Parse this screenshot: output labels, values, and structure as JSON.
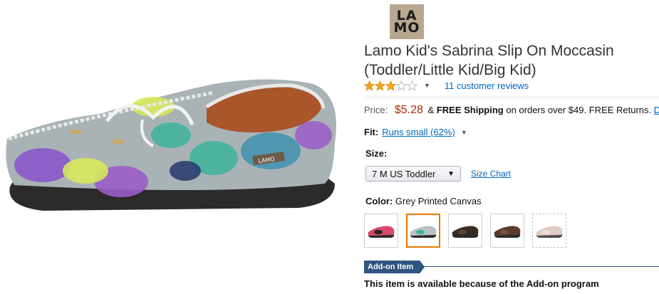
{
  "brand": {
    "logo_text_line1": "LA",
    "logo_text_line2": "MO"
  },
  "product": {
    "title": "Lamo Kid's Sabrina Slip On Moccasin (Toddler/Little Kid/Big Kid)",
    "shoe_tag": "LAMO"
  },
  "rating": {
    "stars": 3,
    "max_stars": 5,
    "reviews_label": "11 customer reviews"
  },
  "price": {
    "label": "Price:",
    "value": "$5.28",
    "amp": "&",
    "free_shipping": "FREE Shipping",
    "conditions": "on orders over $49.",
    "free_returns": "FREE Returns.",
    "link_fragment": "D"
  },
  "fit": {
    "label": "Fit:",
    "value": "Runs small (62%)"
  },
  "size": {
    "label": "Size:",
    "selected": "7 M US Toddler",
    "chart_link": "Size Chart"
  },
  "color": {
    "label": "Color:",
    "selected": "Grey Printed Canvas",
    "swatches": [
      {
        "name": "pink-zebra",
        "upper": "#d94a6a",
        "pattern": "#222222",
        "selected": false
      },
      {
        "name": "grey-printed-canvas",
        "upper": "#b8c2c8",
        "pattern": "#3bb89a",
        "selected": true
      },
      {
        "name": "dark-brown",
        "upper": "#3a2a20",
        "pattern": "#5a4434",
        "selected": false
      },
      {
        "name": "brown",
        "upper": "#5c3a2e",
        "pattern": "#7a5444",
        "selected": false
      },
      {
        "name": "tan-unavailable",
        "upper": "#d9c4b6",
        "pattern": "#e8d8cc",
        "selected": false
      }
    ]
  },
  "addon": {
    "badge": "Add-on Item",
    "text": "This item is available because of the Add-on program",
    "color": "#2f5580"
  },
  "colors": {
    "link": "#0066c0",
    "price": "#b12704",
    "star": "#f4a41c",
    "selected_border": "#e77600"
  }
}
